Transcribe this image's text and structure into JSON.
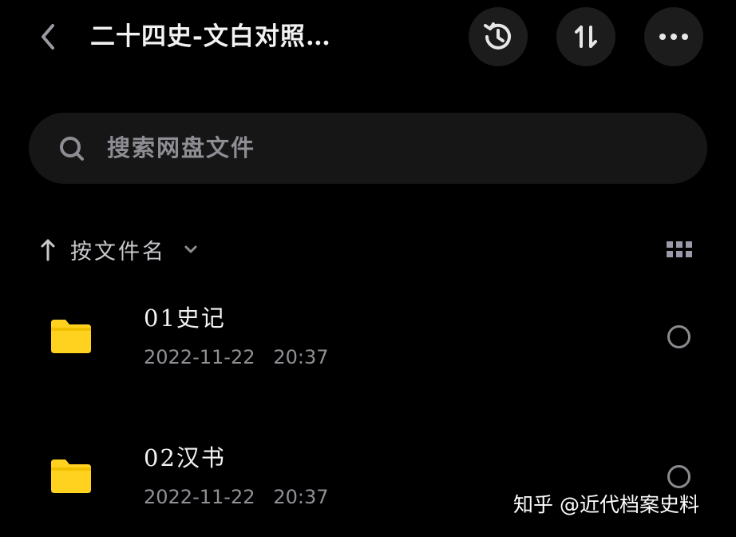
{
  "header": {
    "title": "二十四史-文白对照…",
    "back_icon": "chevron-left-icon",
    "actions": [
      {
        "icon": "history-icon"
      },
      {
        "icon": "sort-icon"
      },
      {
        "icon": "more-icon"
      }
    ]
  },
  "search": {
    "icon": "search-icon",
    "placeholder": "搜索网盘文件"
  },
  "sort": {
    "direction_icon": "arrow-up-icon",
    "label": "按文件名",
    "dropdown_icon": "chevron-down-icon",
    "view_toggle_icon": "grid-view-icon"
  },
  "files": [
    {
      "name": "01史记",
      "date": "2022-11-22",
      "time": "20:37",
      "icon": "folder-icon"
    },
    {
      "name": "02汉书",
      "date": "2022-11-22",
      "time": "20:37",
      "icon": "folder-icon"
    }
  ],
  "watermark": "知乎 @近代档案史料",
  "colors": {
    "background": "#000000",
    "button_bg": "#1c1c1c",
    "search_bg": "#161616",
    "folder": "#ffd21f",
    "secondary_text": "#909096"
  }
}
